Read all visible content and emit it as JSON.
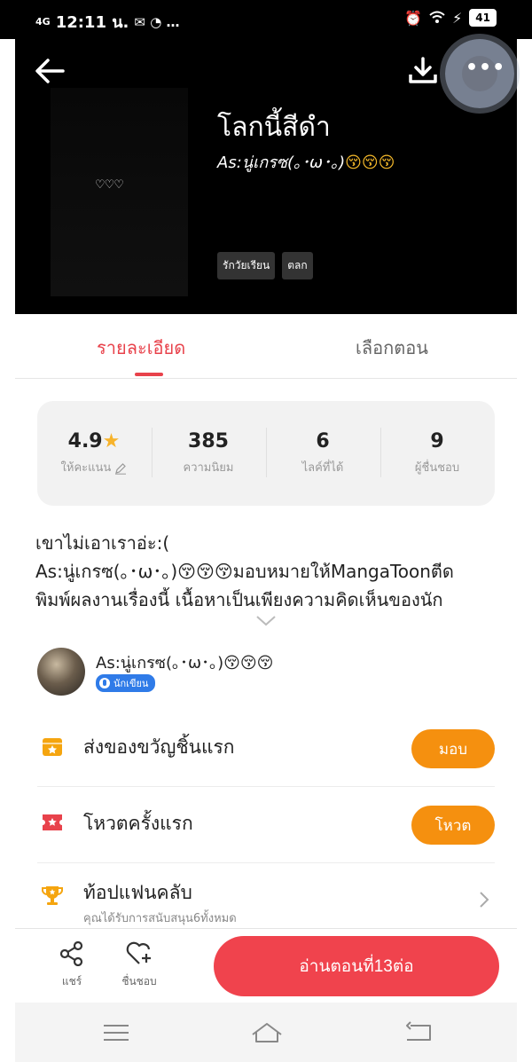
{
  "status_bar": {
    "network": "4G",
    "time": "12:11 น.",
    "notif_glyphs": "✉ ◔ …",
    "battery": "41"
  },
  "hero": {
    "cover_hearts": "♡♡♡",
    "title": "โลกนี้สีดำ",
    "author_prefix": "As:นู่เกรซ(｡･ω･｡)",
    "author_emoji": "😚😚😚",
    "tags": [
      "รักวัยเรียน",
      "ตลก"
    ]
  },
  "tabs": {
    "details": "รายละเอียด",
    "episodes": "เลือกตอน"
  },
  "stats": [
    {
      "value": "4.9",
      "label": "ให้คะแนน",
      "icon": "star-icon"
    },
    {
      "value": "385",
      "label": "ความนิยม"
    },
    {
      "value": "6",
      "label": "ไลค์ที่ได้"
    },
    {
      "value": "9",
      "label": "ผู้ชื่นชอบ"
    }
  ],
  "description": {
    "line1": "เขาไม่เอาเราอ่ะ:(",
    "line2": "As:นู่เกรซ(｡･ω･｡)😚😚😚มอบหมายให้MangaToonตีด",
    "line3": "พิมพ์ผลงานเรื่องนี้ เนื้อหาเป็นเพียงความคิดเห็นของนัก"
  },
  "author": {
    "name": "As:นู่เกรซ(｡･ω･｡)😚😚😚",
    "badge": "นักเขียน"
  },
  "actions": {
    "gift_text": "ส่งของขวัญชิ้นแรก",
    "gift_button": "มอบ",
    "vote_text": "โหวตครั้งแรก",
    "vote_button": "โหวต",
    "fan_title": "ท้อปแฟนคลับ",
    "fan_sub": "คุณได้รับการสนับสนุน6ทั้งหมด"
  },
  "bottom_bar": {
    "share": "แชร์",
    "favorite": "ชื่นชอบ",
    "read_button": "อ่านตอนที่13ต่อ"
  },
  "colors": {
    "accent_red": "#f0434d",
    "tab_red": "#e8424b",
    "orange": "#f5900f",
    "star": "#f7b32b",
    "badge_blue": "#2f7be8"
  }
}
